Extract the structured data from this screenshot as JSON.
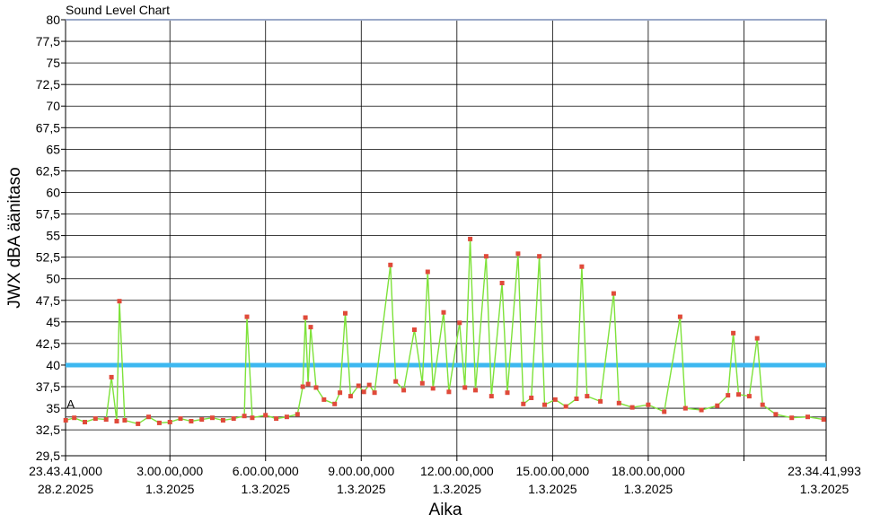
{
  "chart_data": {
    "type": "line",
    "title": "Sound Level Chart",
    "ylabel": "JWX dBA äänitaso",
    "xlabel": "Aika",
    "ylim": [
      29.5,
      80
    ],
    "y_ticks": [
      "29,5",
      "32,5",
      "35",
      "37,5",
      "40",
      "42,5",
      "45",
      "47,5",
      "50",
      "52,5",
      "55",
      "57,5",
      "60",
      "62,5",
      "65",
      "67,5",
      "70",
      "72,5",
      "75",
      "77,5",
      "80"
    ],
    "x_range": [
      "2025-02-28T23:43:41",
      "2025-03-01T23:34:41.993"
    ],
    "x_ticks": [
      {
        "time": "2025-02-28T23:43:41",
        "line1": "23.43.41,000",
        "line2": "28.2.2025"
      },
      {
        "time": "2025-03-01T03:00:00",
        "line1": "3.00.00,000",
        "line2": "1.3.2025"
      },
      {
        "time": "2025-03-01T06:00:00",
        "line1": "6.00.00,000",
        "line2": "1.3.2025"
      },
      {
        "time": "2025-03-01T09:00:00",
        "line1": "9.00.00,000",
        "line2": "1.3.2025"
      },
      {
        "time": "2025-03-01T12:00:00",
        "line1": "12.00.00,000",
        "line2": "1.3.2025"
      },
      {
        "time": "2025-03-01T15:00:00",
        "line1": "15.00.00,000",
        "line2": "1.3.2025"
      },
      {
        "time": "2025-03-01T18:00:00",
        "line1": "18.00.00,000",
        "line2": "1.3.2025"
      },
      {
        "time": "2025-03-01T21:00:00",
        "line1": "",
        "line2": ""
      },
      {
        "time": "2025-03-01T23:34:41.993",
        "line1": "23.34.41,993",
        "line2": "1.3.2025"
      }
    ],
    "threshold": {
      "value": 40,
      "color": "#3db8f0"
    },
    "reference_line": {
      "value": 34,
      "label": "A",
      "color": "#333333"
    },
    "top_line": {
      "value": 80,
      "color": "#9aa8c8"
    },
    "series": [
      {
        "line_color": "#7ee23a",
        "marker_color": "#e04a3a",
        "points": [
          [
            "2025-02-28T23:44:00",
            33.6
          ],
          [
            "2025-03-01T00:00:00",
            33.9
          ],
          [
            "2025-03-01T00:20:00",
            33.4
          ],
          [
            "2025-03-01T00:40:00",
            33.8
          ],
          [
            "2025-03-01T01:00:00",
            33.7
          ],
          [
            "2025-03-01T01:10:00",
            38.6
          ],
          [
            "2025-03-01T01:20:00",
            33.5
          ],
          [
            "2025-03-01T01:25:00",
            47.4
          ],
          [
            "2025-03-01T01:35:00",
            33.6
          ],
          [
            "2025-03-01T02:00:00",
            33.2
          ],
          [
            "2025-03-01T02:20:00",
            34.0
          ],
          [
            "2025-03-01T02:40:00",
            33.3
          ],
          [
            "2025-03-01T03:00:00",
            33.4
          ],
          [
            "2025-03-01T03:20:00",
            33.8
          ],
          [
            "2025-03-01T03:40:00",
            33.5
          ],
          [
            "2025-03-01T04:00:00",
            33.7
          ],
          [
            "2025-03-01T04:20:00",
            33.9
          ],
          [
            "2025-03-01T04:40:00",
            33.6
          ],
          [
            "2025-03-01T05:00:00",
            33.8
          ],
          [
            "2025-03-01T05:20:00",
            34.1
          ],
          [
            "2025-03-01T05:25:00",
            45.6
          ],
          [
            "2025-03-01T05:35:00",
            33.9
          ],
          [
            "2025-03-01T06:00:00",
            34.2
          ],
          [
            "2025-03-01T06:20:00",
            33.8
          ],
          [
            "2025-03-01T06:40:00",
            34.0
          ],
          [
            "2025-03-01T07:00:00",
            34.3
          ],
          [
            "2025-03-01T07:10:00",
            37.5
          ],
          [
            "2025-03-01T07:15:00",
            45.5
          ],
          [
            "2025-03-01T07:20:00",
            37.8
          ],
          [
            "2025-03-01T07:25:00",
            44.4
          ],
          [
            "2025-03-01T07:35:00",
            37.4
          ],
          [
            "2025-03-01T07:50:00",
            36.0
          ],
          [
            "2025-03-01T08:10:00",
            35.5
          ],
          [
            "2025-03-01T08:20:00",
            36.8
          ],
          [
            "2025-03-01T08:30:00",
            46.0
          ],
          [
            "2025-03-01T08:40:00",
            36.4
          ],
          [
            "2025-03-01T08:55:00",
            37.6
          ],
          [
            "2025-03-01T09:05:00",
            36.9
          ],
          [
            "2025-03-01T09:15:00",
            37.7
          ],
          [
            "2025-03-01T09:25:00",
            36.8
          ],
          [
            "2025-03-01T09:55:00",
            51.6
          ],
          [
            "2025-03-01T10:05:00",
            38.1
          ],
          [
            "2025-03-01T10:20:00",
            37.1
          ],
          [
            "2025-03-01T10:40:00",
            44.1
          ],
          [
            "2025-03-01T10:55:00",
            37.9
          ],
          [
            "2025-03-01T11:05:00",
            50.8
          ],
          [
            "2025-03-01T11:15:00",
            37.3
          ],
          [
            "2025-03-01T11:35:00",
            46.1
          ],
          [
            "2025-03-01T11:45:00",
            36.9
          ],
          [
            "2025-03-01T12:05:00",
            44.9
          ],
          [
            "2025-03-01T12:15:00",
            37.4
          ],
          [
            "2025-03-01T12:25:00",
            54.6
          ],
          [
            "2025-03-01T12:35:00",
            37.1
          ],
          [
            "2025-03-01T12:55:00",
            52.6
          ],
          [
            "2025-03-01T13:05:00",
            36.4
          ],
          [
            "2025-03-01T13:25:00",
            49.5
          ],
          [
            "2025-03-01T13:35:00",
            36.8
          ],
          [
            "2025-03-01T13:55:00",
            52.9
          ],
          [
            "2025-03-01T14:05:00",
            35.5
          ],
          [
            "2025-03-01T14:20:00",
            36.2
          ],
          [
            "2025-03-01T14:35:00",
            52.6
          ],
          [
            "2025-03-01T14:45:00",
            35.4
          ],
          [
            "2025-03-01T15:05:00",
            36.0
          ],
          [
            "2025-03-01T15:25:00",
            35.2
          ],
          [
            "2025-03-01T15:45:00",
            36.1
          ],
          [
            "2025-03-01T15:55:00",
            51.4
          ],
          [
            "2025-03-01T16:05:00",
            36.4
          ],
          [
            "2025-03-01T16:30:00",
            35.8
          ],
          [
            "2025-03-01T16:55:00",
            48.3
          ],
          [
            "2025-03-01T17:05:00",
            35.6
          ],
          [
            "2025-03-01T17:30:00",
            35.1
          ],
          [
            "2025-03-01T18:00:00",
            35.4
          ],
          [
            "2025-03-01T18:30:00",
            34.6
          ],
          [
            "2025-03-01T19:00:00",
            45.6
          ],
          [
            "2025-03-01T19:10:00",
            35.0
          ],
          [
            "2025-03-01T19:40:00",
            34.8
          ],
          [
            "2025-03-01T20:10:00",
            35.3
          ],
          [
            "2025-03-01T20:30:00",
            36.5
          ],
          [
            "2025-03-01T20:40:00",
            43.7
          ],
          [
            "2025-03-01T20:50:00",
            36.6
          ],
          [
            "2025-03-01T21:10:00",
            36.4
          ],
          [
            "2025-03-01T21:25:00",
            43.1
          ],
          [
            "2025-03-01T21:35:00",
            35.4
          ],
          [
            "2025-03-01T22:00:00",
            34.3
          ],
          [
            "2025-03-01T22:30:00",
            33.9
          ],
          [
            "2025-03-01T23:00:00",
            34.0
          ],
          [
            "2025-03-01T23:30:00",
            33.7
          ]
        ]
      }
    ]
  }
}
